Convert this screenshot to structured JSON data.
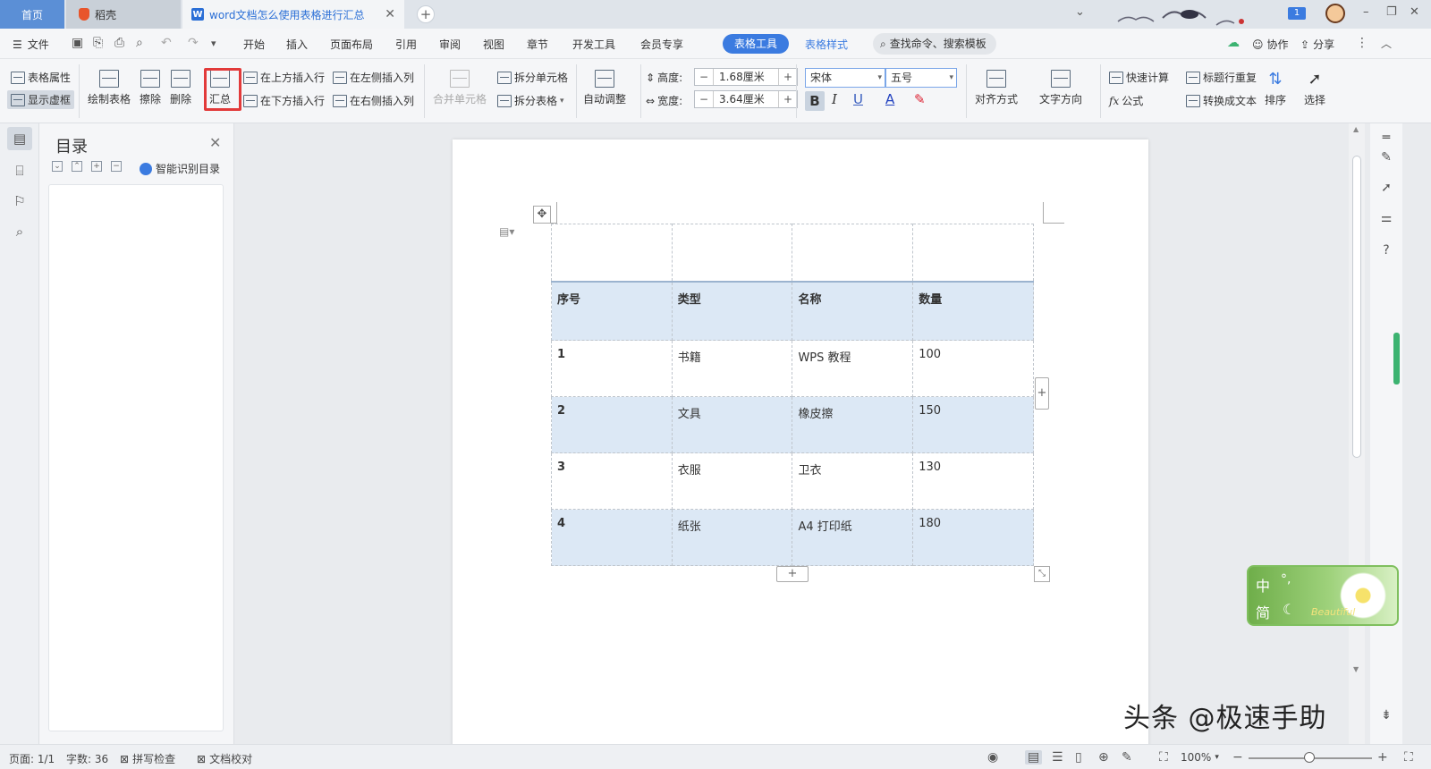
{
  "tabs": {
    "home": "首页",
    "daoke": "稻壳",
    "doc": "word文档怎么使用表格进行汇总",
    "close": "✕",
    "new": "+"
  },
  "titlebar": {
    "badge": "1",
    "minimize": "–",
    "restore": "❐",
    "close": "✕"
  },
  "menubar": {
    "file": "文件",
    "items": [
      "开始",
      "插入",
      "页面布局",
      "引用",
      "审阅",
      "视图",
      "章节",
      "开发工具",
      "会员专享"
    ],
    "table_tools": "表格工具",
    "table_style": "表格样式",
    "search": "查找命令、搜索模板",
    "collab": "协作",
    "share": "分享"
  },
  "ribbon": {
    "table_props": "表格属性",
    "show_gridlines": "显示虚框",
    "draw_table": "绘制表格",
    "erase": "擦除",
    "delete": "删除",
    "summary": "汇总",
    "insert_above": "在上方插入行",
    "insert_below": "在下方插入行",
    "insert_left": "在左侧插入列",
    "insert_right": "在右侧插入列",
    "merge_cells": "合并单元格",
    "split_cells": "拆分单元格",
    "split_table": "拆分表格",
    "auto_fit": "自动调整",
    "height_label": "高度:",
    "height_value": "1.68厘米",
    "width_label": "宽度:",
    "width_value": "3.64厘米",
    "font_name": "宋体",
    "font_size": "五号",
    "bold": "B",
    "italic": "I",
    "underline": "U",
    "font_color": "A",
    "align": "对齐方式",
    "text_dir": "文字方向",
    "quick_calc": "快速计算",
    "formula": "公式",
    "repeat_header": "标题行重复",
    "convert_text": "转换成文本",
    "sort": "排序",
    "select": "选择"
  },
  "navpane": {
    "title": "目录",
    "smart_toc": "智能识别目录"
  },
  "table": {
    "header": [
      "序号",
      "类型",
      "名称",
      "数量"
    ],
    "rows": [
      [
        "1",
        "书籍",
        "WPS 教程",
        "100"
      ],
      [
        "2",
        "文具",
        "橡皮擦",
        "150"
      ],
      [
        "3",
        "衣服",
        "卫衣",
        "130"
      ],
      [
        "4",
        "纸张",
        "A4 打印纸",
        "180"
      ]
    ]
  },
  "ime": {
    "lang": "中",
    "punct": "°,",
    "simp": "简",
    "moon": "☾",
    "brand": "Beautiful"
  },
  "watermark": "头条 @极速手助",
  "statusbar": {
    "page": "页面: 1/1",
    "words": "字数: 36",
    "spell": "拼写检查",
    "proof": "文档校对",
    "zoom": "100%"
  },
  "colors": {
    "accent": "#3b7be0",
    "highlight_box": "#e23a3a",
    "table_shade": "#dce8f5"
  }
}
